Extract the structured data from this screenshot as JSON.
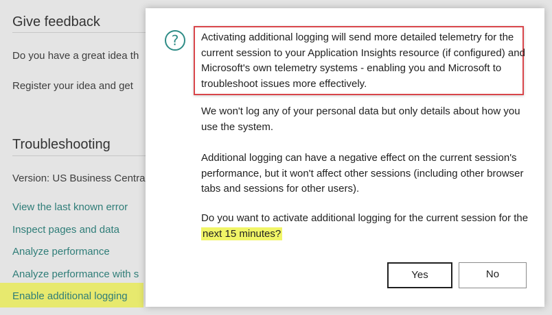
{
  "background": {
    "feedback_heading": "Give feedback",
    "feedback_line1": "Do you have a great idea th",
    "feedback_line2": "Register your idea and get",
    "troubleshooting_heading": "Troubleshooting",
    "version_text": "Version: US Business Centra",
    "links": [
      "View the last known error",
      "Inspect pages and data",
      "Analyze performance",
      "Analyze performance with s",
      "Enable additional logging"
    ]
  },
  "dialog": {
    "icon": "question-circle-icon",
    "paragraph1": "Activating additional logging will send more detailed telemetry for the current session to your Application Insights resource (if configured) and Microsoft's own telemetry systems - enabling you and Microsoft to troubleshoot issues more effectively.",
    "paragraph2": "We won't log any of your personal data but only details about how you use the system.",
    "paragraph3": "Additional logging can have a negative effect on the current session's performance, but it won't affect other sessions (including other browser tabs and sessions for other users).",
    "paragraph4_prefix": "Do you want to activate additional logging for the current session for the",
    "paragraph4_highlight": "next 15 minutes?",
    "yes_label": "Yes",
    "no_label": "No"
  },
  "colors": {
    "link": "#2f7d78",
    "highlight": "#f1f567",
    "annotation_box": "#d9454a",
    "icon": "#2e8c86"
  }
}
